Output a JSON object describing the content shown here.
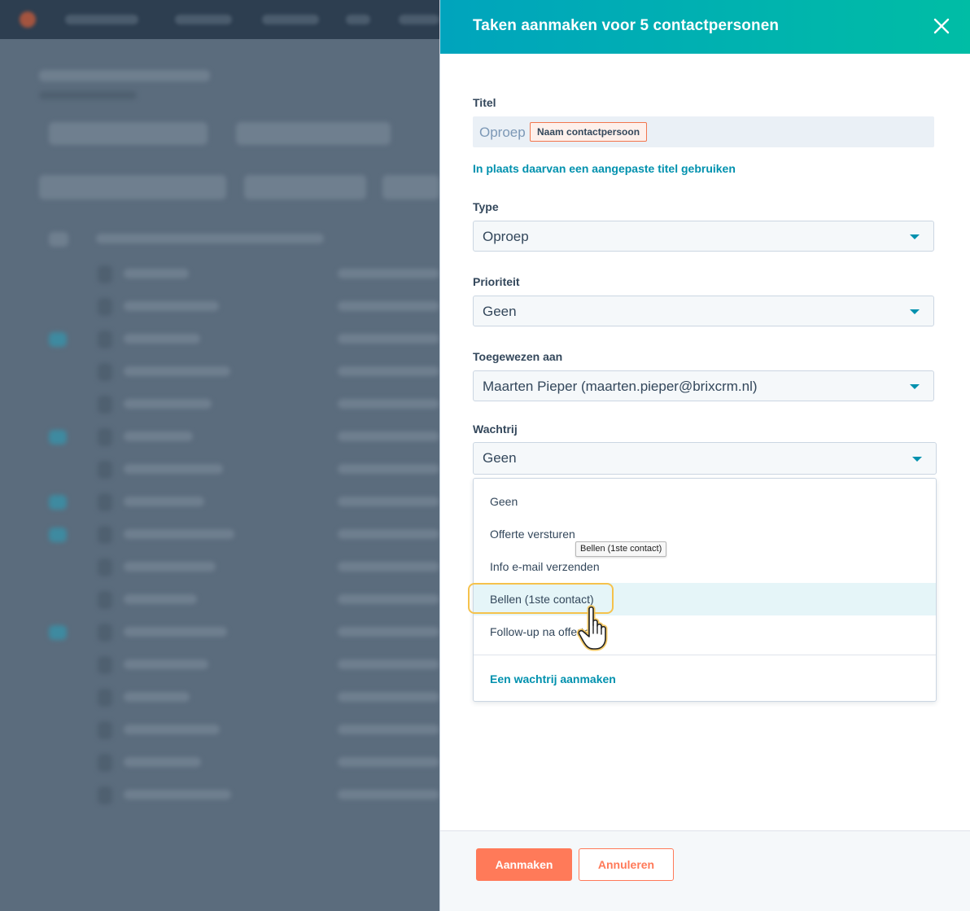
{
  "panel": {
    "title": "Taken aanmaken voor 5 contactpersonen",
    "close_icon": "close-icon"
  },
  "title_field": {
    "label": "Titel",
    "prefix": "Oproep",
    "token": "Naam contactpersoon",
    "custom_title_link": "In plaats daarvan een aangepaste titel gebruiken"
  },
  "type_field": {
    "label": "Type",
    "value": "Oproep"
  },
  "priority_field": {
    "label": "Prioriteit",
    "value": "Geen"
  },
  "assignee_field": {
    "label": "Toegewezen aan",
    "value": "Maarten Pieper (maarten.pieper@brixcrm.nl)"
  },
  "queue_field": {
    "label": "Wachtrij",
    "value": "Geen",
    "options": [
      "Geen",
      "Offerte versturen",
      "Info e-mail verzenden",
      "Bellen (1ste contact)",
      "Follow-up na offerte"
    ],
    "highlighted": "Bellen (1ste contact)",
    "create_link": "Een wachtrij aanmaken",
    "tooltip": "Bellen (1ste contact)"
  },
  "footer": {
    "create_label": "Aanmaken",
    "cancel_label": "Annuleren"
  },
  "colors": {
    "header_start": "#00a4bd",
    "header_end": "#00bda5",
    "primary_button": "#ff7a59",
    "link": "#0091ae",
    "highlight_ring": "#f5c24c"
  }
}
